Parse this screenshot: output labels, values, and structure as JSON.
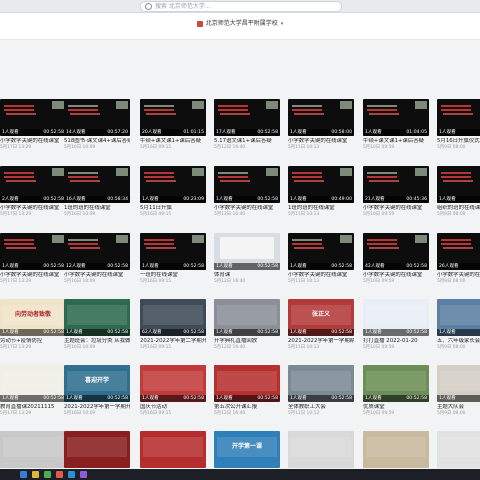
{
  "search": {
    "placeholder": "搜索 北京师范大学..."
  },
  "org": {
    "name": "北京师范大学昌平附属学校"
  },
  "rows": [
    [
      {
        "title": "小学数学关键的在线课堂",
        "views": "1人观看",
        "duration": "00:52:58",
        "theme": "dark",
        "accent": "#b33"
      },
      {
        "title": "518图书·课文课4+课后答疑",
        "views": "14人观看",
        "duration": "00:57:20",
        "theme": "dark",
        "accent": "#7d8a7a"
      },
      {
        "title": "牛顿+课文课1+课后答疑",
        "views": "20人观看",
        "duration": "01:01:15",
        "theme": "dark",
        "accent": "#7d8a7a"
      },
      {
        "title": "5.17语文课1+课后答疑",
        "views": "17人观看",
        "duration": "00:52:58",
        "theme": "dark",
        "accent": "#b33"
      },
      {
        "title": "小学数学关键的在线课堂",
        "views": "1人观看",
        "duration": "00:58:00",
        "theme": "dark",
        "accent": "#7d8a7a"
      },
      {
        "title": "牛顿+课文课1+课后答疑",
        "views": "1人观看",
        "duration": "01:04:05",
        "theme": "dark",
        "accent": "#7d8a7a"
      },
      {
        "title": "5月16日升旗仪式",
        "views": "1人观看",
        "duration": "00:52:58",
        "theme": "dark",
        "accent": "#b33"
      }
    ],
    [
      {
        "title": "小学数学关键的在线课堂",
        "views": "2人观看",
        "duration": "00:52:58",
        "theme": "dark",
        "accent": "#b33"
      },
      {
        "title": "1班的班的在线课堂",
        "views": "16人观看",
        "duration": "00:58:34",
        "theme": "dark",
        "accent": "#7d8a7a"
      },
      {
        "title": "5月11日升旗",
        "views": "1人观看",
        "duration": "00:23:09",
        "theme": "dark",
        "accent": "#b33"
      },
      {
        "title": "小学数学关键的在线课堂",
        "views": "1人观看",
        "duration": "00:52:58",
        "theme": "dark",
        "accent": "#7d8a7a"
      },
      {
        "title": "1班的班的在线课堂",
        "views": "1人观看",
        "duration": "00:49:00",
        "theme": "dark",
        "accent": "#b33"
      },
      {
        "title": "小学数学关键的在线课堂",
        "views": "21人观看",
        "duration": "00:45:36",
        "theme": "dark",
        "accent": "#7d8a7a"
      },
      {
        "title": "组织的班的在线课堂",
        "views": "1人观看",
        "duration": "00:52:58",
        "theme": "dark",
        "accent": "#b33"
      }
    ],
    [
      {
        "title": "小学数学关键的在线课堂",
        "views": "1人观看",
        "duration": "00:52:58",
        "theme": "dark",
        "accent": "#b33"
      },
      {
        "title": "小学数学关键的在线课堂",
        "views": "12人观看",
        "duration": "00:52:58",
        "theme": "dark",
        "accent": "#7d8a7a"
      },
      {
        "title": "一班的在线课堂",
        "views": "1人观看",
        "duration": "00:52:58",
        "theme": "dark",
        "accent": "#b33"
      },
      {
        "title": "体育课",
        "views": "1人观看",
        "duration": "00:52:58",
        "theme": "light",
        "accent": "#3a7bd5"
      },
      {
        "title": "小学数学关键的在线课堂",
        "views": "1人观看",
        "duration": "00:52:58",
        "theme": "dark",
        "accent": "#7d8a7a"
      },
      {
        "title": "小学数学关键的在线课堂",
        "views": "42人观看",
        "duration": "00:52:58",
        "theme": "dark",
        "accent": "#b33"
      },
      {
        "title": "小学数学关键的在线课堂",
        "views": "26人观看",
        "duration": "00:52:58",
        "theme": "dark",
        "accent": "#b33"
      }
    ],
    [
      {
        "title": "劳动节+疫情防控",
        "views": "1人观看",
        "duration": "00:52:58",
        "theme": "banner",
        "accent": "#f1e3c8",
        "caption": "向劳动者致敬"
      },
      {
        "title": "主题班会：垃圾分类  从我做起",
        "views": "1人观看",
        "duration": "00:52:58",
        "theme": "banner",
        "accent": "#2d6a4f"
      },
      {
        "title": "2021-2022学年第二学期开学第一课",
        "views": "62人观看",
        "duration": "00:52:58",
        "theme": "banner",
        "accent": "#3f4b57"
      },
      {
        "title": "开学典礼直播回放",
        "views": "1人观看",
        "duration": "00:52:58",
        "theme": "banner",
        "accent": "#8a8f98"
      },
      {
        "title": "2021-2022学年第一学期期末总结",
        "views": "1人观看",
        "duration": "00:52:58",
        "theme": "banner",
        "accent": "#b23a3a",
        "caption": "张正义"
      },
      {
        "title": "打打直播 2022-01-20",
        "views": "1人观看",
        "duration": "00:52:58",
        "theme": "banner",
        "accent": "#e8eef5"
      },
      {
        "title": "五、六年级家长会",
        "views": "1人观看",
        "duration": "00:52:58",
        "theme": "banner",
        "accent": "#5c7fa3"
      }
    ],
    [
      {
        "title": "教育直播课20211115",
        "views": "1人观看",
        "duration": "00:52:58",
        "theme": "banner",
        "accent": "#f0efe6",
        "caption": ""
      },
      {
        "title": "2021-2022学年第一学期开学典礼",
        "views": "1人观看",
        "duration": "00:52:58",
        "theme": "banner",
        "accent": "#2f6f8f",
        "caption": "喜迎开学"
      },
      {
        "title": "国庆节活动",
        "views": "1人观看",
        "duration": "00:52:58",
        "theme": "banner",
        "accent": "#c23b3b"
      },
      {
        "title": "第五次公开课汇报",
        "views": "1人观看",
        "duration": "00:52:58",
        "theme": "banner",
        "accent": "#b73030",
        "caption": ""
      },
      {
        "title": "全体教职工大会",
        "views": "1人观看",
        "duration": "00:52:58",
        "theme": "banner",
        "accent": "#7c8a94"
      },
      {
        "title": "优质课堂",
        "views": "1人观看",
        "duration": "00:52:58",
        "theme": "banner",
        "accent": "#6b8f56"
      },
      {
        "title": "主题大队会",
        "views": "1人观看",
        "duration": "00:52:58",
        "theme": "banner",
        "accent": "#d3cfc4"
      }
    ],
    [
      {
        "title": "",
        "views": "",
        "duration": "",
        "theme": "banner",
        "accent": "#c8c8c8"
      },
      {
        "title": "",
        "views": "",
        "duration": "",
        "theme": "banner",
        "accent": "#8a1f1f"
      },
      {
        "title": "",
        "views": "",
        "duration": "",
        "theme": "banner",
        "accent": "#b52d2d"
      },
      {
        "title": "",
        "views": "",
        "duration": "",
        "theme": "banner",
        "accent": "#2f7fb8",
        "caption": "开学第一课"
      },
      {
        "title": "",
        "views": "",
        "duration": "",
        "theme": "banner",
        "accent": "#d9d9d9"
      },
      {
        "title": "",
        "views": "",
        "duration": "",
        "theme": "banner",
        "accent": "#c9b99e"
      },
      {
        "title": "",
        "views": "",
        "duration": "",
        "theme": "banner",
        "accent": "#e2e2e2"
      }
    ]
  ],
  "dates": [
    "5月17日 13:29",
    "5月16日 10:09",
    "5月16日 09:15",
    "5月12日 16:40",
    "5月11日 10:13",
    "5月10日 09:59",
    "5月9日 08:00"
  ],
  "taskbar": [
    "#3a7bd5",
    "#e0b33a",
    "#4caf50",
    "#e05a47",
    "#2b8fd6",
    "#8e5cd9"
  ]
}
